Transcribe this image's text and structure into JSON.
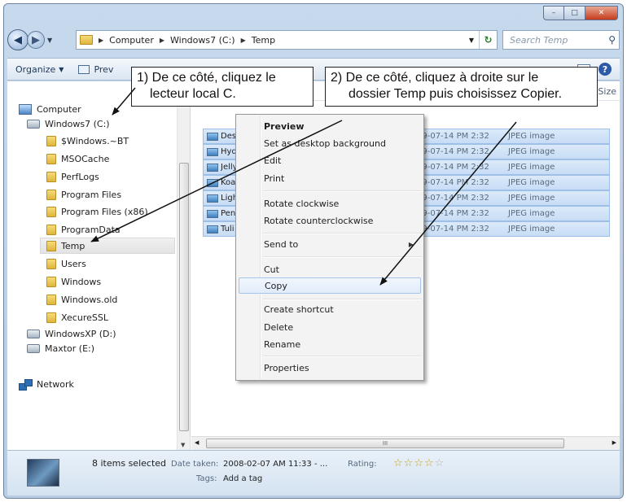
{
  "window": {
    "caption": {
      "minimize": "–",
      "maximize": "□",
      "close": "✕"
    }
  },
  "address_bar": {
    "crumbs": [
      "Computer",
      "Windows7 (C:)",
      "Temp"
    ],
    "search_placeholder": "Search Temp"
  },
  "toolbar": {
    "organize": "Organize",
    "preview": "Prev"
  },
  "nav_tree": {
    "computer": "Computer",
    "drive_c": "Windows7 (C:)",
    "folders": [
      "$Windows.~BT",
      "MSOCache",
      "PerfLogs",
      "Program Files",
      "Program Files (x86)",
      "ProgramData",
      "Temp",
      "Users",
      "Windows",
      "Windows.old",
      "XecureSSL"
    ],
    "drive_d": "WindowsXP (D:)",
    "drive_e": "Maxtor (E:)",
    "network": "Network"
  },
  "file_list": {
    "size_header": "Size",
    "rows": [
      {
        "name": "Dese",
        "date": "09-07-14 PM 2:32",
        "type": "JPEG image"
      },
      {
        "name": "Hyd",
        "date": "09-07-14 PM 2:32",
        "type": "JPEG image"
      },
      {
        "name": "Jelly",
        "date": "09-07-14 PM 2:32",
        "type": "JPEG image"
      },
      {
        "name": "Koal",
        "date": "09-07-14 PM 2:32",
        "type": "JPEG image"
      },
      {
        "name": "Ligh",
        "date": "09-07-14 PM 2:32",
        "type": "JPEG image"
      },
      {
        "name": "Pen",
        "date": "09-07-14 PM 2:32",
        "type": "JPEG image"
      },
      {
        "name": "Tuli",
        "date": "09-07-14 PM 2:32",
        "type": "JPEG image"
      }
    ]
  },
  "context_menu": {
    "preview": "Preview",
    "set_background": "Set as desktop background",
    "edit": "Edit",
    "print": "Print",
    "rotate_cw": "Rotate clockwise",
    "rotate_ccw": "Rotate counterclockwise",
    "send_to": "Send to",
    "cut": "Cut",
    "copy": "Copy",
    "create_shortcut": "Create shortcut",
    "delete": "Delete",
    "rename": "Rename",
    "properties": "Properties"
  },
  "details": {
    "count": "8 items selected",
    "date_label": "Date taken:",
    "date_value": "2008-02-07 AM 11:33 - ...",
    "tags_label": "Tags:",
    "tags_value": "Add a tag",
    "rating_label": "Rating:",
    "rating_value": 0
  },
  "callouts": {
    "one_line1": "1) De ce côté, cliquez le",
    "one_line2": "lecteur local C.",
    "two_line1": "2) De ce côté, cliquez à droite sur le",
    "two_line2": "dossier Temp puis choisissez Copier."
  },
  "h_scroll_grip": "III"
}
